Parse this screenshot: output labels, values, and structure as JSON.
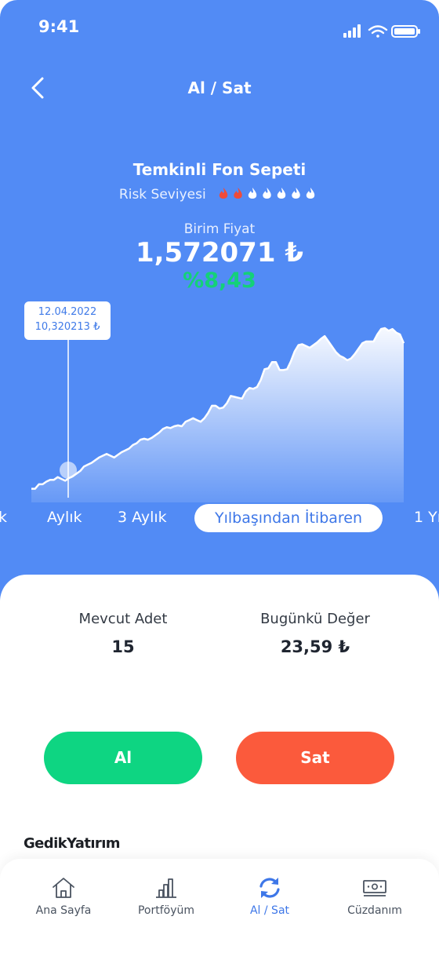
{
  "status_bar": {
    "time": "9:41"
  },
  "header": {
    "title": "Al / Sat"
  },
  "fund": {
    "name": "Temkinli Fon Sepeti",
    "risk_label": "Risk Seviyesi",
    "risk_level": 2,
    "risk_max": 7,
    "risk_active_color": "#ef4b3a",
    "risk_inactive_color": "#ffffff",
    "price_label": "Birim Fiyat",
    "price": "1,572071 ₺",
    "change": "%8,43",
    "change_color": "#14d178"
  },
  "chart_data": {
    "type": "area",
    "selected_point": {
      "date": "12.04.2022",
      "value": "10,320213 ₺"
    },
    "values": [
      3,
      3,
      8,
      8,
      11,
      13,
      13,
      16,
      14,
      12,
      15,
      17,
      20,
      23,
      28,
      30,
      32,
      35,
      38,
      40,
      42,
      40,
      38,
      41,
      44,
      46,
      48,
      52,
      54,
      58,
      59,
      58,
      60,
      63,
      66,
      70,
      72,
      71,
      73,
      74,
      73,
      78,
      80,
      82,
      80,
      78,
      82,
      88,
      96,
      96,
      93,
      94,
      99,
      107,
      106,
      105,
      104,
      112,
      116,
      115,
      117,
      125,
      137,
      138,
      145,
      145,
      136,
      136,
      137,
      146,
      157,
      164,
      165,
      163,
      161,
      164,
      167,
      171,
      174,
      168,
      162,
      156,
      152,
      150,
      147,
      149,
      154,
      160,
      166,
      168,
      168,
      168,
      176,
      182,
      183,
      180,
      182,
      178,
      176,
      166
    ]
  },
  "periods": [
    {
      "label": "k"
    },
    {
      "label": "Aylık"
    },
    {
      "label": "3 Aylık"
    },
    {
      "label": "Yılbaşından İtibaren",
      "active": true
    },
    {
      "label": "1 Yı"
    }
  ],
  "holdings": {
    "quantity_label": "Mevcut Adet",
    "quantity": "15",
    "value_label": "Bugünkü Değer",
    "value": "23,59 ₺"
  },
  "actions": {
    "buy": "Al",
    "sell": "Sat",
    "buy_color": "#0ed582",
    "sell_color": "#fb5a3c"
  },
  "brand": {
    "name": "GedikYatırım"
  },
  "tabbar": {
    "items": [
      {
        "label": "Ana Sayfa",
        "icon": "home-icon"
      },
      {
        "label": "Portföyüm",
        "icon": "bar-chart-icon"
      },
      {
        "label": "Al / Sat",
        "icon": "sync-icon",
        "active": true
      },
      {
        "label": "Cüzdanım",
        "icon": "wallet-icon"
      }
    ]
  }
}
